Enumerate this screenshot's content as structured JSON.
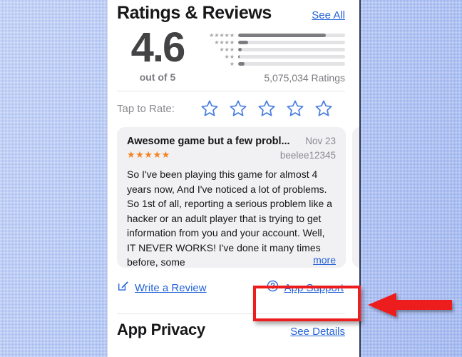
{
  "header": {
    "title": "Ratings & Reviews",
    "see_all_label": "See All"
  },
  "summary": {
    "score": "4.6",
    "out_of_label": "out of 5",
    "ratings_count": "5,075,034 Ratings",
    "bars": [
      {
        "stars_label": "★★★★★",
        "percent": 82
      },
      {
        "stars_label": "★★★★",
        "percent": 9
      },
      {
        "stars_label": "★★★",
        "percent": 3
      },
      {
        "stars_label": "★★",
        "percent": 1.5
      },
      {
        "stars_label": "★",
        "percent": 6
      }
    ]
  },
  "tap_to_rate": {
    "label": "Tap to Rate:",
    "star_count": 5
  },
  "review": {
    "title": "Awesome game but a few probl...",
    "date": "Nov 23",
    "stars": "★★★★★",
    "username": "beelee12345",
    "body": "So I've been playing this game for almost 4 years now, And I've noticed a lot of problems. So 1st of all, reporting a serious problem like a hacker or an adult player that is trying to get information from you and your account. Well, IT NEVER WORKS! I've done it many times before, some",
    "more_label": "more"
  },
  "actions": {
    "write_review_label": "Write a Review",
    "write_review_icon": "compose-icon",
    "app_support_label": "App Support",
    "app_support_icon": "question-circle-icon"
  },
  "app_privacy": {
    "title": "App Privacy",
    "see_details_label": "See Details"
  },
  "annotation": {
    "highlight_color": "#ee1d1d",
    "arrow_direction": "left",
    "arrow_color": "#ee1d1d"
  },
  "colors": {
    "link_blue": "#2563d8",
    "star_orange": "#f5821f",
    "bar_fill_gray": "#7c7c81",
    "bar_track_gray": "#e3e3e6",
    "card_gray": "#f1f1f4",
    "backdrop_blue": "#97b0ee"
  }
}
